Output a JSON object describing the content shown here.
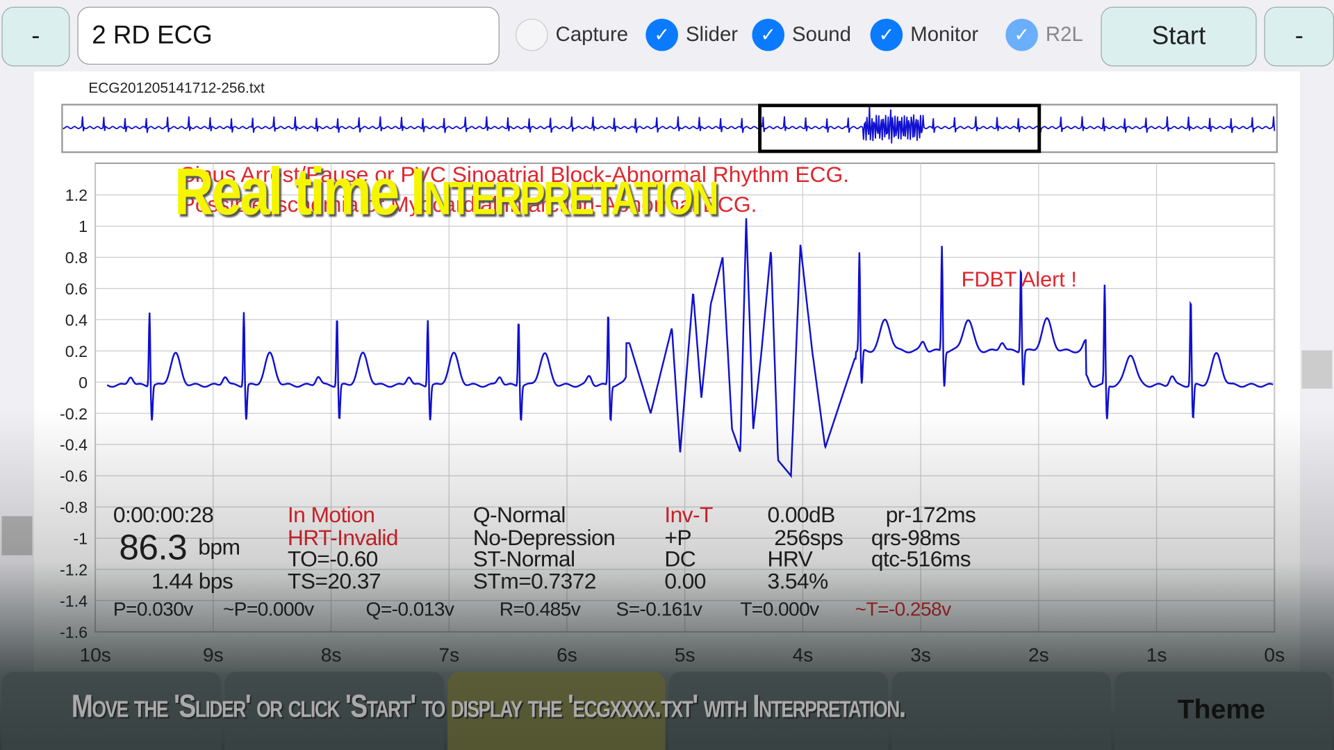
{
  "toolbar": {
    "left_button": "-",
    "file_field_value": "2 RD ECG",
    "checkboxes": [
      {
        "label": "Capture",
        "checked": false
      },
      {
        "label": "Slider",
        "checked": true
      },
      {
        "label": "Sound",
        "checked": true
      },
      {
        "label": "Monitor",
        "checked": true
      },
      {
        "label": "R2L",
        "checked": true
      }
    ],
    "start_button": "Start",
    "right_button": "-"
  },
  "file_name": "ECG201205141712-256.txt",
  "overview": {
    "window_start_fraction": 0.575,
    "window_end_fraction": 0.805
  },
  "interpretation": {
    "line1": "Sinus Arrest/Pause or PVC Sinoatrial Block-Abnormal Rhythm ECG.",
    "line2": "Possible Ischemia or Myocardial Infarction-Abnormal ECG.",
    "alert": "FDBT Alert !"
  },
  "overlay": {
    "title_main": "Real time ",
    "title_caps": "Interpretation",
    "caption": "Move the 'Slider' or click 'Start' to display the 'ecgxxxx.txt' with Interpretation."
  },
  "stats": {
    "time": "0:00:00:28",
    "bpm_value": "86.3",
    "bpm_unit": "bpm",
    "bps": "1.44 bps",
    "motion": "In Motion",
    "hrt": "HRT-Invalid",
    "to": "TO=-0.60",
    "ts": "TS=20.37",
    "q_status": "Q-Normal",
    "depression": "No-Depression",
    "st": "ST-Normal",
    "stm": "STm=0.7372",
    "invt": "Inv-T",
    "plus_p": "+P",
    "dc": "DC",
    "dc_value": "0.00",
    "db": "0.00dB",
    "sps": "256sps",
    "hrv": "HRV",
    "hrv_value": "3.54%",
    "pr": "pr-172ms",
    "qrs": "qrs-98ms",
    "qtc": "qtc-516ms",
    "amplitudes": [
      "P=0.030v",
      "~P=0.000v",
      "Q=-0.013v",
      "R=0.485v",
      "S=-0.161v",
      "T=0.000v",
      "~T=-0.258v"
    ]
  },
  "bottom_bar": {
    "theme_label": "Theme"
  },
  "colors": {
    "trace": "#1010d0",
    "alert": "#e0262d",
    "overlay_title": "#f5f500",
    "checkbox": "#0a7aff"
  },
  "chart_data": {
    "type": "line",
    "xlabel": "",
    "ylabel": "",
    "x_ticks": [
      "10s",
      "9s",
      "8s",
      "7s",
      "6s",
      "5s",
      "4s",
      "3s",
      "2s",
      "1s",
      "0s"
    ],
    "y_ticks": [
      "1.2",
      "1",
      "0.8",
      "0.6",
      "0.4",
      "0.2",
      "0",
      "-0.2",
      "-0.4",
      "-0.6",
      "-0.8",
      "-1",
      "-1.2",
      "-1.4",
      "-1.6"
    ],
    "xlim": [
      10,
      0
    ],
    "ylim": [
      -1.6,
      1.4
    ],
    "grid": true,
    "beats_seconds": [
      9.54,
      8.74,
      7.95,
      7.18,
      6.41,
      5.65,
      3.52,
      2.82,
      2.15,
      1.44,
      0.71
    ],
    "beat_r_values": [
      0.48,
      0.48,
      0.45,
      0.43,
      0.43,
      0.47,
      0.63,
      0.68,
      0.55,
      0.64,
      0.56
    ],
    "irregular_segment": [
      [
        5.47,
        0.25
      ],
      [
        5.29,
        -0.2
      ],
      [
        5.11,
        0.35
      ],
      [
        5.04,
        -0.45
      ],
      [
        4.93,
        0.58
      ],
      [
        4.86,
        -0.1
      ],
      [
        4.78,
        0.5
      ],
      [
        4.68,
        0.8
      ],
      [
        4.6,
        -0.3
      ],
      [
        4.53,
        -0.45
      ],
      [
        4.48,
        1.05
      ],
      [
        4.42,
        -0.3
      ],
      [
        4.35,
        0.2
      ],
      [
        4.27,
        0.85
      ],
      [
        4.21,
        -0.5
      ],
      [
        4.1,
        -0.6
      ],
      [
        4.02,
        0.88
      ],
      [
        3.92,
        0.2
      ],
      [
        3.81,
        -0.42
      ],
      [
        3.67,
        -0.1
      ],
      [
        3.56,
        0.15
      ]
    ]
  }
}
